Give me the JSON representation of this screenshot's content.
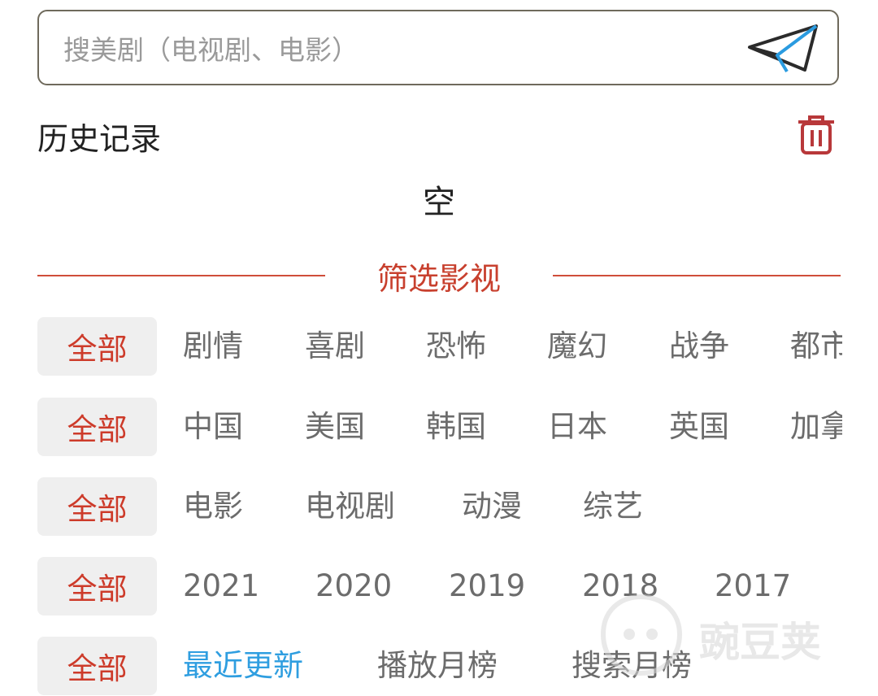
{
  "search": {
    "placeholder": "搜美剧（电视剧、电影）"
  },
  "history": {
    "title": "历史记录",
    "empty_text": "空"
  },
  "filter": {
    "title": "筛选影视",
    "all_label": "全部",
    "rows": [
      [
        "剧情",
        "喜剧",
        "恐怖",
        "魔幻",
        "战争",
        "都市"
      ],
      [
        "中国",
        "美国",
        "韩国",
        "日本",
        "英国",
        "加拿大"
      ],
      [
        "电影",
        "电视剧",
        "动漫",
        "综艺"
      ],
      [
        "2021",
        "2020",
        "2019",
        "2018",
        "2017"
      ],
      [
        "最近更新",
        "播放月榜",
        "搜索月榜"
      ]
    ]
  },
  "watermark": {
    "text": "豌豆荚"
  },
  "colors": {
    "accent": "#c8402e",
    "active_blue": "#2f9ee0",
    "chip_bg": "#efefef"
  }
}
